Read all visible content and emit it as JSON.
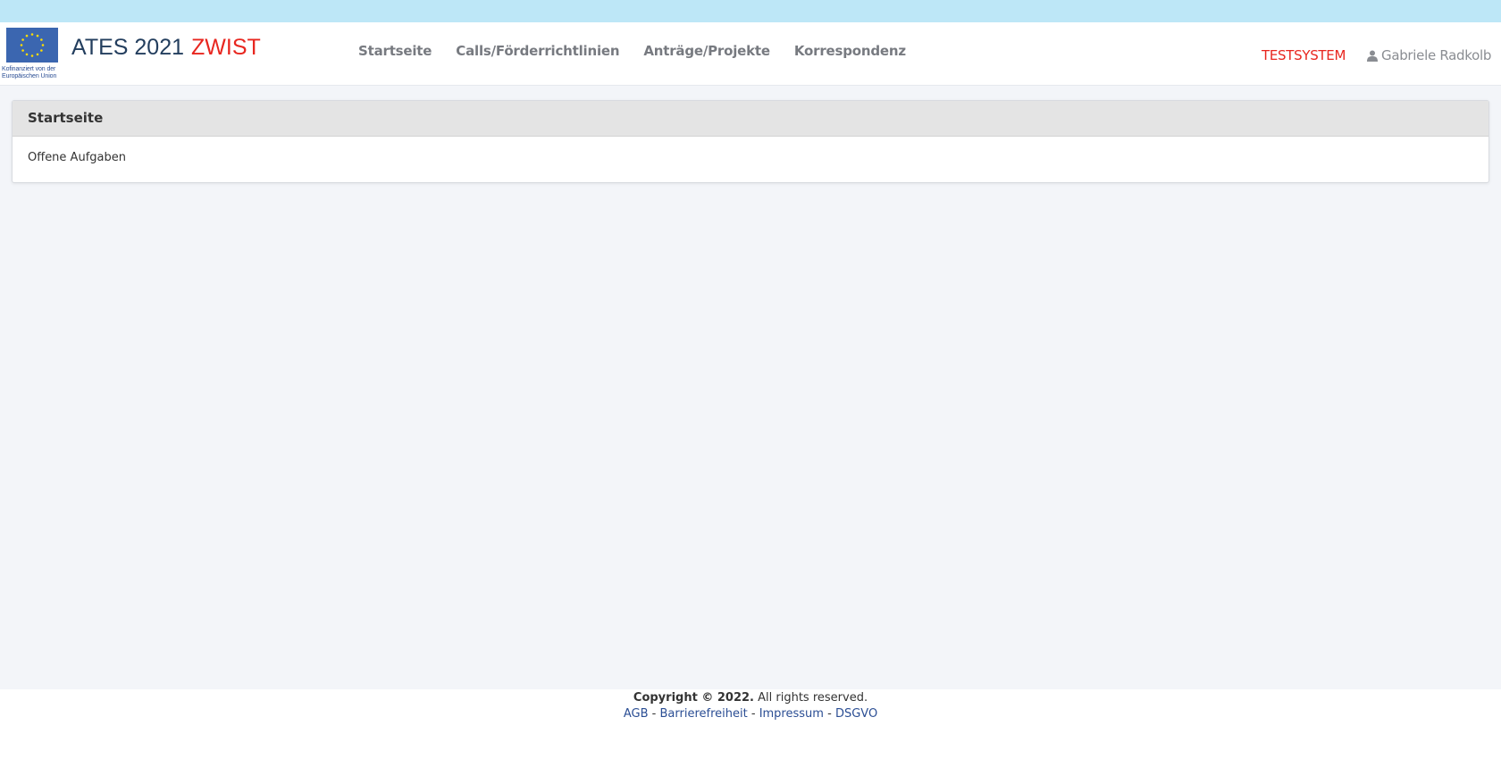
{
  "header": {
    "logo_caption_line1": "Kofinanziert von der",
    "logo_caption_line2": "Europäischen Union",
    "brand_title": "ATES 2021",
    "brand_subtitle": "ZWIST",
    "nav": [
      {
        "label": "Startseite"
      },
      {
        "label": "Calls/Förderrichtlinien"
      },
      {
        "label": "Anträge/Projekte"
      },
      {
        "label": "Korrespondenz"
      }
    ],
    "environment_label": "TESTSYSTEM",
    "user_name": "Gabriele Radkolb",
    "user_icon": "user-icon"
  },
  "main": {
    "panel_title": "Startseite",
    "panel_item": "Offene Aufgaben"
  },
  "footer": {
    "copyright_bold": "Copyright © 2022.",
    "copyright_rest": "All rights reserved.",
    "links": [
      {
        "label": "AGB"
      },
      {
        "label": "Barrierefreiheit"
      },
      {
        "label": "Impressum"
      },
      {
        "label": "DSGVO"
      }
    ],
    "separator": "-"
  },
  "colors": {
    "topbar": "#bde7f7",
    "brand_title": "#233e5e",
    "accent_red": "#e8261f",
    "eu_blue": "#3b66b0",
    "eu_star": "#ffdd00",
    "link_blue": "#2b4e94",
    "background": "#f3f5f9"
  }
}
